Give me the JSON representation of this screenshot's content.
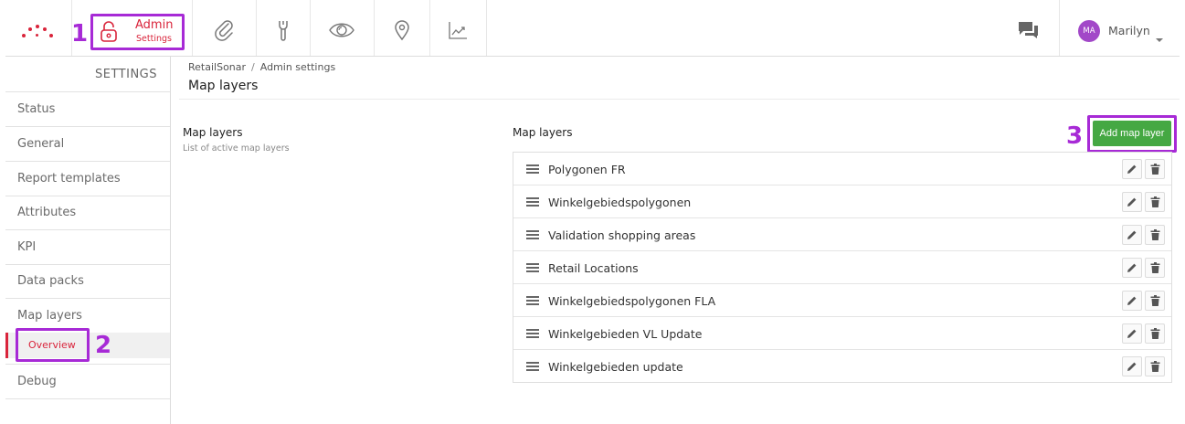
{
  "topnav": {
    "admin_title": "Admin",
    "admin_subtitle": "Settings",
    "nav_icons": [
      "paperclip-icon",
      "wrench-icon",
      "eye-icon",
      "map-pin-icon",
      "chart-icon"
    ],
    "user": {
      "initials": "MA",
      "name": "Marilyn"
    }
  },
  "callouts": {
    "one": "1",
    "two": "2",
    "three": "3"
  },
  "sidebar": {
    "heading": "SETTINGS",
    "items": [
      "Status",
      "General",
      "Report templates",
      "Attributes",
      "KPI",
      "Data packs",
      "Map layers"
    ],
    "sub_item": "Overview",
    "after_item": "Debug"
  },
  "breadcrumb": {
    "root": "RetailSonar",
    "separator": "/",
    "current": "Admin settings"
  },
  "page": {
    "title": "Map layers"
  },
  "left_panel": {
    "title": "Map layers",
    "subtitle": "List of active map layers"
  },
  "layers_panel": {
    "title": "Map layers",
    "add_button": "Add map layer",
    "layers": [
      "Polygonen FR",
      "Winkelgebiedspolygonen",
      "Validation shopping areas",
      "Retail Locations",
      "Winkelgebiedspolygonen FLA",
      "Winkelgebieden VL Update",
      "Winkelgebieden update"
    ]
  },
  "colors": {
    "brand": "#d9243b",
    "accent_callout": "#a72ad6",
    "button_green": "#45a843",
    "avatar": "#a248c8"
  }
}
